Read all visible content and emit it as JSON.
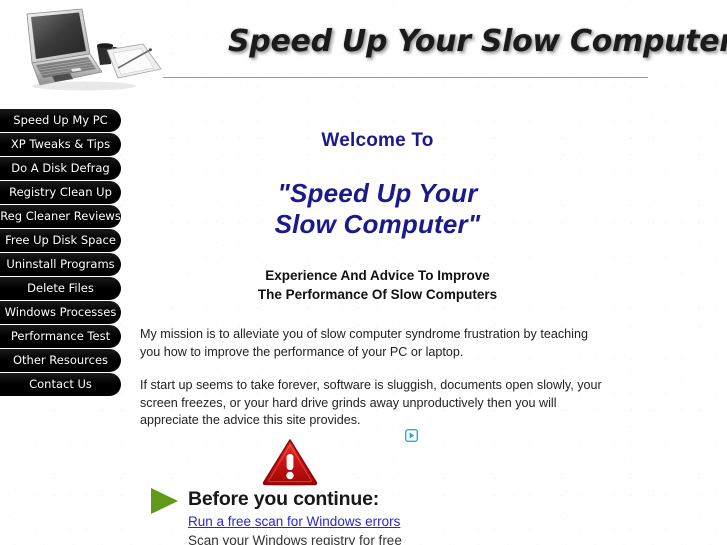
{
  "header": {
    "site_title": "Speed Up Your Slow Computer",
    "logo_alt": "laptop-coffee-mug-notepad-photo"
  },
  "sidebar": {
    "items": [
      {
        "label": "Speed Up My PC"
      },
      {
        "label": "XP Tweaks & Tips"
      },
      {
        "label": "Do A Disk Defrag"
      },
      {
        "label": "Registry Clean Up"
      },
      {
        "label": "Reg Cleaner Reviews"
      },
      {
        "label": "Free Up Disk Space"
      },
      {
        "label": "Uninstall Programs"
      },
      {
        "label": "Delete Files"
      },
      {
        "label": "Windows Processes"
      },
      {
        "label": "Performance Test"
      },
      {
        "label": "Other Resources"
      },
      {
        "label": "Contact Us"
      }
    ]
  },
  "main": {
    "welcome_heading": "Welcome To",
    "headline_line1": "\"Speed Up Your",
    "headline_line2": "Slow Computer\"",
    "subheading_line1": "Experience And Advice To Improve",
    "subheading_line2": "The Performance Of Slow Computers",
    "paragraph_1": "My mission is to alleviate you of slow computer syndrome frustration by teaching you how to improve the performance of your PC or laptop.",
    "paragraph_2": "If start up seems to take forever, software is sluggish, documents open slowly, your screen freezes, or your hard drive grinds away unproductively then you will appreciate the advice this site provides."
  },
  "ad": {
    "adchoices_label": "AdChoices",
    "heading": "Before you continue:",
    "link_text": "Run a free scan for Windows errors",
    "subtext": "Scan your Windows registry for free",
    "warning_icon_name": "red-warning-triangle",
    "play_icon_name": "green-play-triangle"
  },
  "colors": {
    "heading_blue": "#1a1a8c",
    "link_blue": "#2727d6",
    "nav_background": "#000000",
    "nav_text": "#ffffff",
    "warning_red": "#cc1111",
    "play_green": "#5f9a18",
    "adchoices_cyan": "#2fa8dd"
  }
}
